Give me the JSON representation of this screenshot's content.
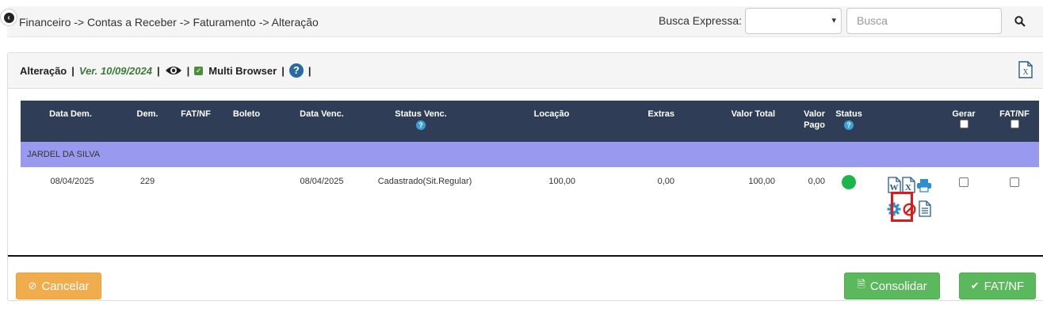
{
  "breadcrumb": "Financeiro -> Contas a Receber -> Faturamento -> Alteração",
  "search": {
    "label": "Busca Expressa:",
    "select_value": "",
    "placeholder": "Busca"
  },
  "panel": {
    "title": "Alteração",
    "version": "Ver. 10/09/2024",
    "multi_browser": "Multi Browser",
    "multi_browser_checked": true
  },
  "table": {
    "headers": {
      "data_dem": "Data Dem.",
      "dem": "Dem.",
      "fat_nf": "FAT/NF",
      "boleto": "Boleto",
      "data_venc": "Data Venc.",
      "status_venc": "Status Venc.",
      "locacao": "Locação",
      "extras": "Extras",
      "valor_total": "Valor Total",
      "valor_pago_1": "Valor",
      "valor_pago_2": "Pago",
      "status": "Status",
      "gerar": "Gerar",
      "fat_nf_check": "FAT/NF"
    },
    "group": "JARDEL DA SILVA",
    "rows": [
      {
        "data_dem": "08/04/2025",
        "dem": "229",
        "fat_nf": "",
        "boleto": "",
        "data_venc": "08/04/2025",
        "status_venc": "Cadastrado(Sit.Regular)",
        "locacao": "100,00",
        "extras": "0,00",
        "valor_total": "100,00",
        "valor_pago": "0,00",
        "status_color": "#1ab64a"
      }
    ]
  },
  "buttons": {
    "cancel": "Cancelar",
    "consolidar": "Consolidar",
    "fatnf": "FAT/NF"
  },
  "icons": {
    "word": "word-doc-icon",
    "excel": "excel-doc-icon",
    "print": "printer-icon",
    "gear": "gear-icon",
    "cancel": "forbidden-icon",
    "doc": "document-icon",
    "eye": "eye-icon"
  },
  "colors": {
    "header_bg": "#2f3e56",
    "group_bg": "#9999f0",
    "warning": "#f0ad4e",
    "success": "#5cb85c",
    "highlight": "#e01818"
  }
}
